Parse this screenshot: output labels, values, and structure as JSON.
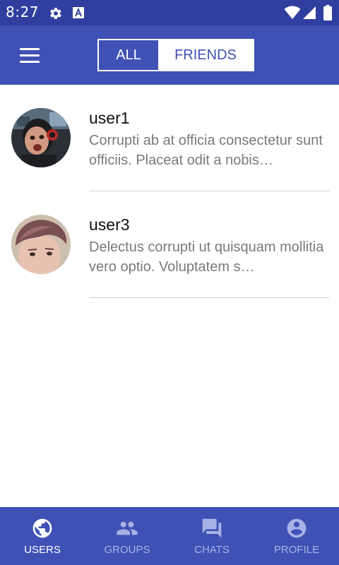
{
  "status_bar": {
    "time": "8:27"
  },
  "app_bar": {
    "tabs": [
      {
        "label": "ALL",
        "selected": true
      },
      {
        "label": "FRIENDS",
        "selected": false
      }
    ]
  },
  "users": [
    {
      "name": "user1",
      "text": "Corrupti ab at officia consectetur sunt officiis. Placeat odit a nobis…"
    },
    {
      "name": "user3",
      "text": "Delectus corrupti ut quisquam mollitia vero optio. Voluptatem s…"
    }
  ],
  "bottom_nav": [
    {
      "label": "USERS",
      "icon": "globe-icon",
      "active": true
    },
    {
      "label": "GROUPS",
      "icon": "people-icon",
      "active": false
    },
    {
      "label": "CHATS",
      "icon": "chat-icon",
      "active": false
    },
    {
      "label": "PROFILE",
      "icon": "account-circle-icon",
      "active": false
    }
  ],
  "colors": {
    "status_bar": "#303f9f",
    "primary": "#3f51b5",
    "inactive_nav": "#a8b2e6",
    "secondary_text": "#7a7a7a"
  }
}
